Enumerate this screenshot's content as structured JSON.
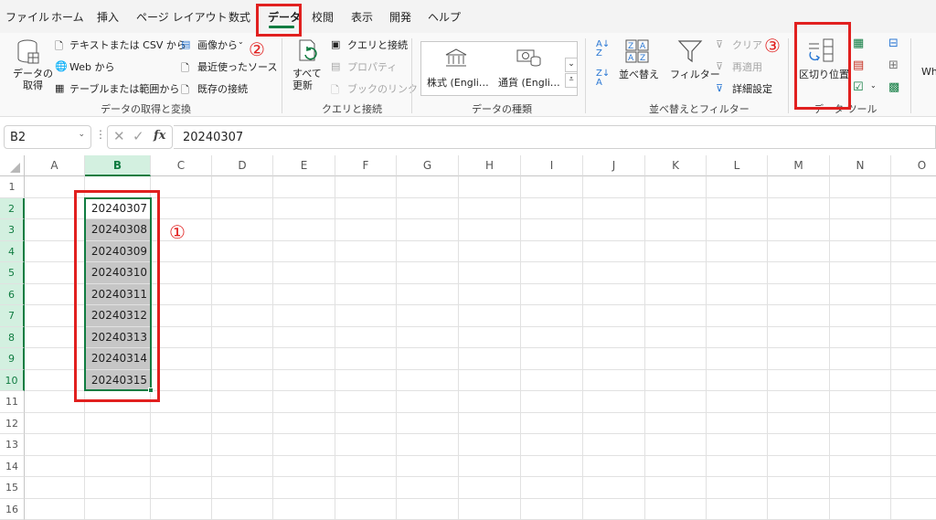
{
  "menu": {
    "tabs": [
      "ファイル",
      "ホーム",
      "挿入",
      "ページ レイアウト",
      "数式",
      "データ",
      "校閲",
      "表示",
      "開発",
      "ヘルプ"
    ],
    "active_tab": "データ"
  },
  "ribbon": {
    "get_data": {
      "get_data_label": "データの\n取得",
      "text_csv": "テキストまたは CSV から",
      "web": "Web から",
      "table_range": "テーブルまたは範囲から",
      "from_picture": "画像から",
      "recent_sources": "最近使ったソース",
      "existing_connections": "既存の接続",
      "group_label": "データの取得と変換"
    },
    "queries": {
      "refresh_all": "すべて\n更新",
      "queries_connections": "クエリと接続",
      "properties": "プロパティ",
      "edit_links": "ブックのリンク",
      "group_label": "クエリと接続"
    },
    "data_types": {
      "stocks": "株式 (Engli…",
      "currencies": "通貨 (Engli…",
      "group_label": "データの種類"
    },
    "sort_filter": {
      "sort": "並べ替え",
      "filter": "フィルター",
      "clear": "クリア",
      "reapply": "再適用",
      "advanced": "詳細設定",
      "group_label": "並べ替えとフィルター"
    },
    "data_tools": {
      "text_to_columns": "区切り位置",
      "group_label": "データ ツール"
    },
    "overflow_label": "Wh"
  },
  "formula_bar": {
    "name_box": "B2",
    "formula": "20240307",
    "fx_label": "fx"
  },
  "columns": [
    "A",
    "B",
    "C",
    "D",
    "E",
    "F",
    "G",
    "H",
    "I",
    "J",
    "K",
    "L",
    "M",
    "N",
    "O"
  ],
  "rows": [
    "1",
    "2",
    "3",
    "4",
    "5",
    "6",
    "7",
    "8",
    "9",
    "10",
    "11",
    "12",
    "13",
    "14",
    "15",
    "16"
  ],
  "cells_b": [
    "20240307",
    "20240308",
    "20240309",
    "20240310",
    "20240311",
    "20240312",
    "20240313",
    "20240314",
    "20240315"
  ],
  "annotations": {
    "marker_1": "①",
    "marker_2": "②",
    "marker_3": "③"
  },
  "colors": {
    "accent": "#107c41",
    "annotation": "#e1201f",
    "selection_fill": "#c6c6c6"
  }
}
